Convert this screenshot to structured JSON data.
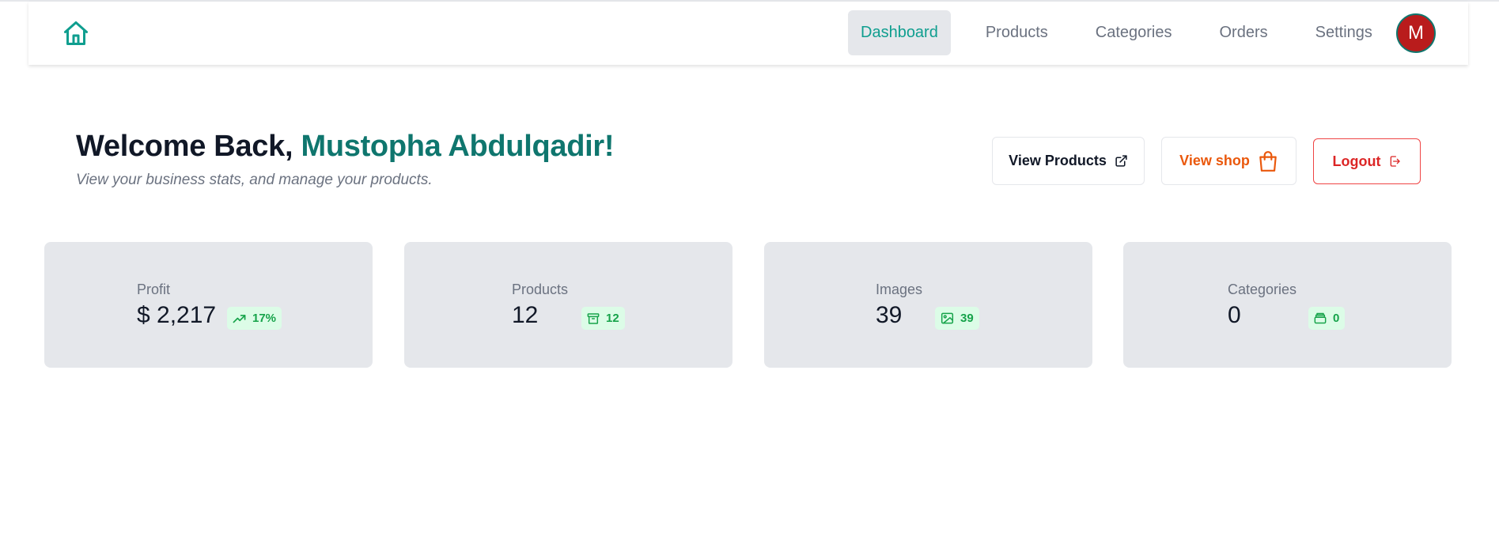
{
  "header": {
    "nav": [
      {
        "label": "Dashboard",
        "active": true
      },
      {
        "label": "Products",
        "active": false
      },
      {
        "label": "Categories",
        "active": false
      },
      {
        "label": "Orders",
        "active": false
      },
      {
        "label": "Settings",
        "active": false
      }
    ],
    "avatar_initial": "M",
    "home_icon": "home-icon"
  },
  "welcome": {
    "greeting": "Welcome Back, ",
    "name": "Mustopha Abdulqadir!",
    "subtitle": "View your business stats, and manage your products."
  },
  "actions": {
    "view_products": "View Products",
    "view_shop": "View shop",
    "logout": "Logout"
  },
  "stats": [
    {
      "label": "Profit",
      "value": "$ 2,217",
      "badge": "17%",
      "icon": "trending-up-icon"
    },
    {
      "label": "Products",
      "value": "12",
      "badge": "12",
      "icon": "archive-icon"
    },
    {
      "label": "Images",
      "value": "39",
      "badge": "39",
      "icon": "image-icon"
    },
    {
      "label": "Categories",
      "value": "0",
      "badge": "0",
      "icon": "folder-icon"
    }
  ],
  "colors": {
    "accent": "#0f766e",
    "active_nav": "#0f9e8f",
    "shop": "#ea580c",
    "logout": "#dc2626",
    "badge_bg": "#dcfce7",
    "badge_text": "#16a34a",
    "card_bg": "#e5e7eb"
  }
}
